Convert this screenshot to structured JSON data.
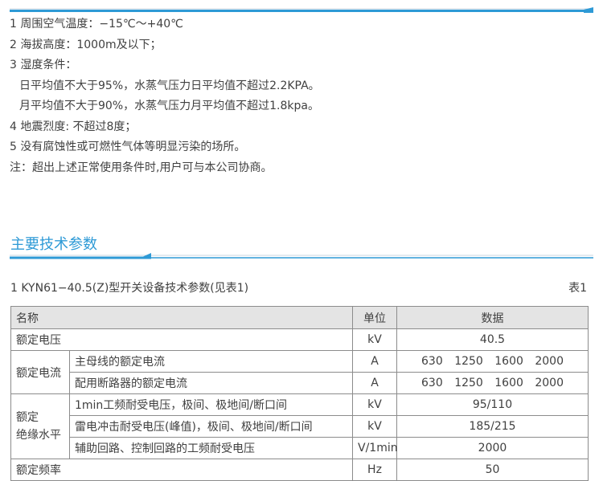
{
  "conditions": [
    "1 周围空气温度：−15℃～+40℃",
    "2 海拔高度：1000m及以下；",
    "3 湿度条件：",
    "日平均值不大于95%，水蒸气压力日平均值不超过2.2KPA。",
    "月平均值不大于90%，水蒸气压力月平均值不超过1.8kpa。",
    "4 地震烈度: 不超过8度；",
    "5 没有腐蚀性或可燃性气体等明显污染的场所。",
    "注：超出上述正常使用条件时,用户可与本公司协商。"
  ],
  "section_title": "主要技术参数",
  "table_caption": "1 KYN61−40.5(Z)型开关设备技术参数(见表1)",
  "table_number": "表1",
  "table": {
    "headers": {
      "name": "名称",
      "unit": "单位",
      "data": "数据"
    },
    "rows": {
      "rated_voltage": {
        "name": "额定电压",
        "unit": "kV",
        "value": "40.5"
      },
      "rated_current": {
        "group": "额定电流",
        "main_bus": {
          "name": "主母线的额定电流",
          "unit": "A",
          "value": "630 1250 1600 2000"
        },
        "feeder": {
          "name": "配用断路器的额定电流",
          "unit": "A",
          "value": "630 1250 1600 2000"
        }
      },
      "insulation": {
        "group_line1": "额定",
        "group_line2": "绝缘水平",
        "power_freq": {
          "name": "1min工频耐受电压，极间、极地间/断口间",
          "unit": "kV",
          "value": "95/110"
        },
        "lightning": {
          "name": "雷电冲击耐受电压(峰值)，极间、极地间/断口间",
          "unit": "kV",
          "value": "185/215"
        },
        "auxiliary": {
          "name": "辅助回路、控制回路的工频耐受电压",
          "unit": "V/1min",
          "value": "2000"
        }
      },
      "rated_frequency": {
        "name": "额定频率",
        "unit": "Hz",
        "value": "50"
      }
    }
  },
  "colors": {
    "accent": "#2e9ad6",
    "header_bg": "#e4e4e4",
    "border": "#8c8c8c",
    "text": "#404040"
  }
}
